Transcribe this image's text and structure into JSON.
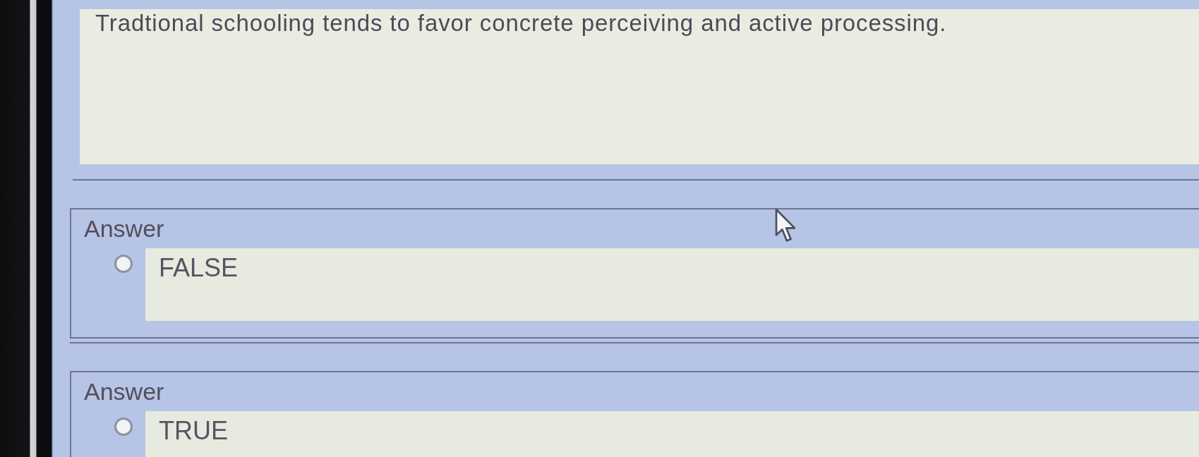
{
  "question": {
    "text": "Tradtional schooling tends to favor concrete perceiving and active processing."
  },
  "answers": [
    {
      "label": "Answer",
      "option": "FALSE",
      "selected": false
    },
    {
      "label": "Answer",
      "option": "TRUE",
      "selected": false
    }
  ]
}
